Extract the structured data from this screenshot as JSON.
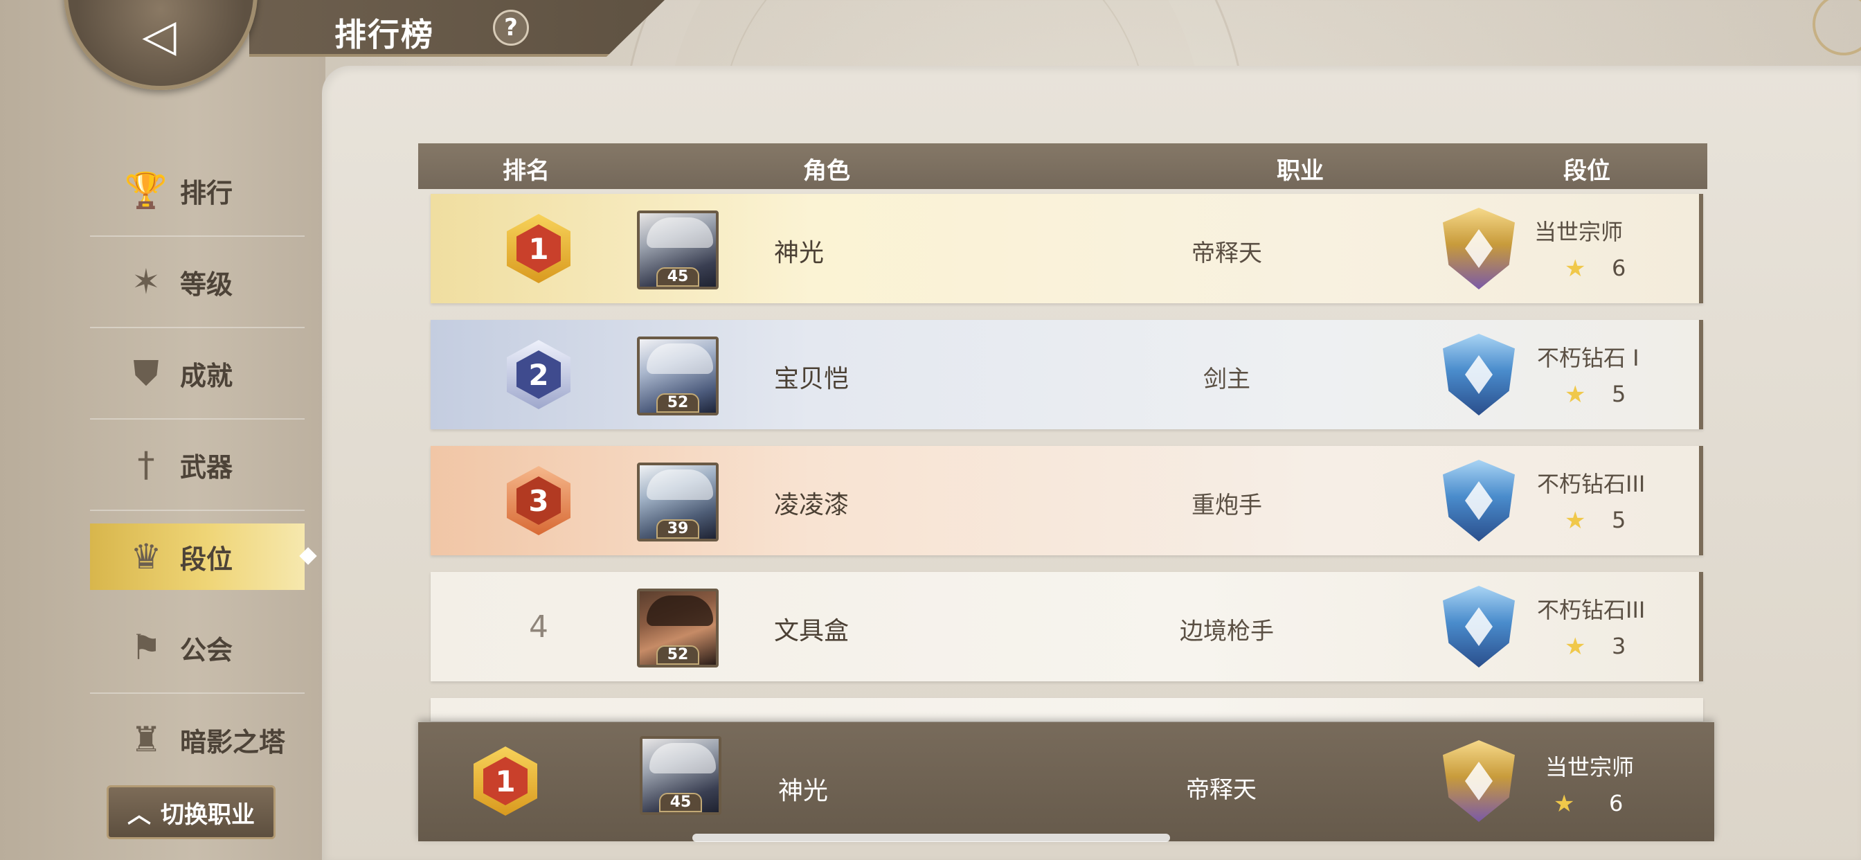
{
  "header": {
    "title": "排行榜",
    "help_icon": "?"
  },
  "sidebar": {
    "items": [
      {
        "label": "排行",
        "icon": "trophy-icon"
      },
      {
        "label": "等级",
        "icon": "star-burst-icon"
      },
      {
        "label": "成就",
        "icon": "shield-badge-icon"
      },
      {
        "label": "武器",
        "icon": "sword-icon"
      },
      {
        "label": "段位",
        "icon": "crown-medal-icon",
        "active": true
      },
      {
        "label": "公会",
        "icon": "banner-icon"
      },
      {
        "label": "暗影之塔",
        "icon": "tower-icon"
      }
    ],
    "switch_button": "切换职业"
  },
  "table": {
    "columns": [
      "排名",
      "角色",
      "职业",
      "段位"
    ],
    "rows": [
      {
        "rank": "1",
        "level": "45",
        "name": "神光",
        "job": "帝释天",
        "tier": "当世宗师",
        "stars": "6"
      },
      {
        "rank": "2",
        "level": "52",
        "name": "宝贝恺",
        "job": "剑主",
        "tier": "不朽钻石 I",
        "stars": "5"
      },
      {
        "rank": "3",
        "level": "39",
        "name": "凌凌漆",
        "job": "重炮手",
        "tier": "不朽钻石III",
        "stars": "5"
      },
      {
        "rank": "4",
        "level": "52",
        "name": "文具盒",
        "job": "边境枪手",
        "tier": "不朽钻石III",
        "stars": "3"
      }
    ]
  },
  "my_rank": {
    "rank": "1",
    "level": "45",
    "name": "神光",
    "job": "帝释天",
    "tier": "当世宗师",
    "stars": "6"
  },
  "colors": {
    "accent_gold": "#efd577",
    "header_brown": "#74685a",
    "star": "#f0c84a"
  }
}
